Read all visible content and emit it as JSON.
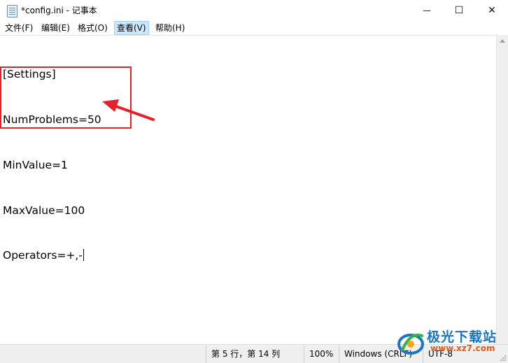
{
  "window": {
    "title": "*config.ini - 记事本",
    "minimize_glyph": "—",
    "maximize_glyph": "☐",
    "close_glyph": "✕"
  },
  "menu": {
    "file": "文件(F)",
    "edit": "编辑(E)",
    "format": "格式(O)",
    "view": "查看(V)",
    "help": "帮助(H)"
  },
  "editor": {
    "lines": [
      "[Settings]",
      "NumProblems=50",
      "MinValue=1",
      "MaxValue=100",
      "Operators=+,-"
    ]
  },
  "status": {
    "position": "第 5 行，第 14 列",
    "zoom": "100%",
    "line_ending": "Windows (CRLF)",
    "encoding": "UTF-8"
  },
  "watermark": {
    "brand": "极光下载站",
    "url": "www.xz7.com"
  },
  "colors": {
    "annotation": "#e4212b",
    "menu_active_bg": "#cce8ff",
    "statusbar_bg": "#f0f0f0"
  }
}
